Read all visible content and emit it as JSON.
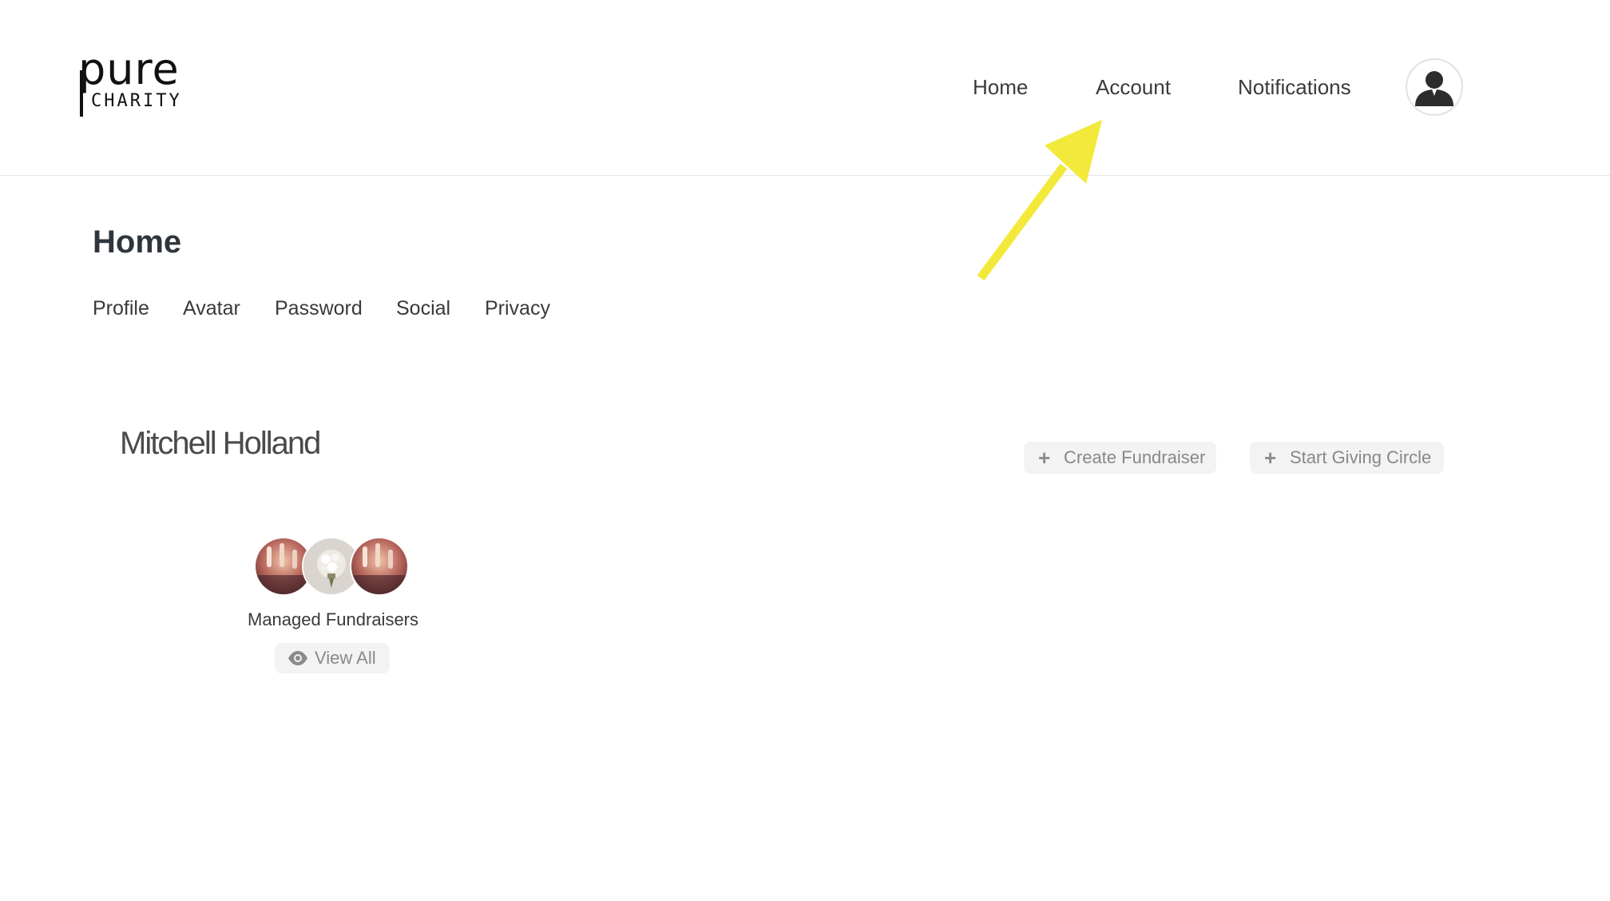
{
  "brand": {
    "logo_top": "pure",
    "logo_bottom": "CHARITY"
  },
  "nav": {
    "items": [
      {
        "label": "Home"
      },
      {
        "label": "Account"
      },
      {
        "label": "Notifications"
      }
    ],
    "avatar_icon": "user-silhouette-icon"
  },
  "page": {
    "title": "Home",
    "tabs": [
      {
        "label": "Profile"
      },
      {
        "label": "Avatar"
      },
      {
        "label": "Password"
      },
      {
        "label": "Social"
      },
      {
        "label": "Privacy"
      }
    ]
  },
  "profile": {
    "name": "Mitchell Holland",
    "actions": [
      {
        "label": "Create Fundraiser",
        "icon": "plus-icon"
      },
      {
        "label": "Start Giving Circle",
        "icon": "plus-icon"
      }
    ],
    "managed": {
      "label": "Managed Fundraisers",
      "view_all_label": "View All",
      "view_all_icon": "eye-icon"
    }
  },
  "colors": {
    "annotation_arrow": "#f2e93a",
    "button_bg": "#f3f3f3",
    "heading": "#2f353c"
  }
}
